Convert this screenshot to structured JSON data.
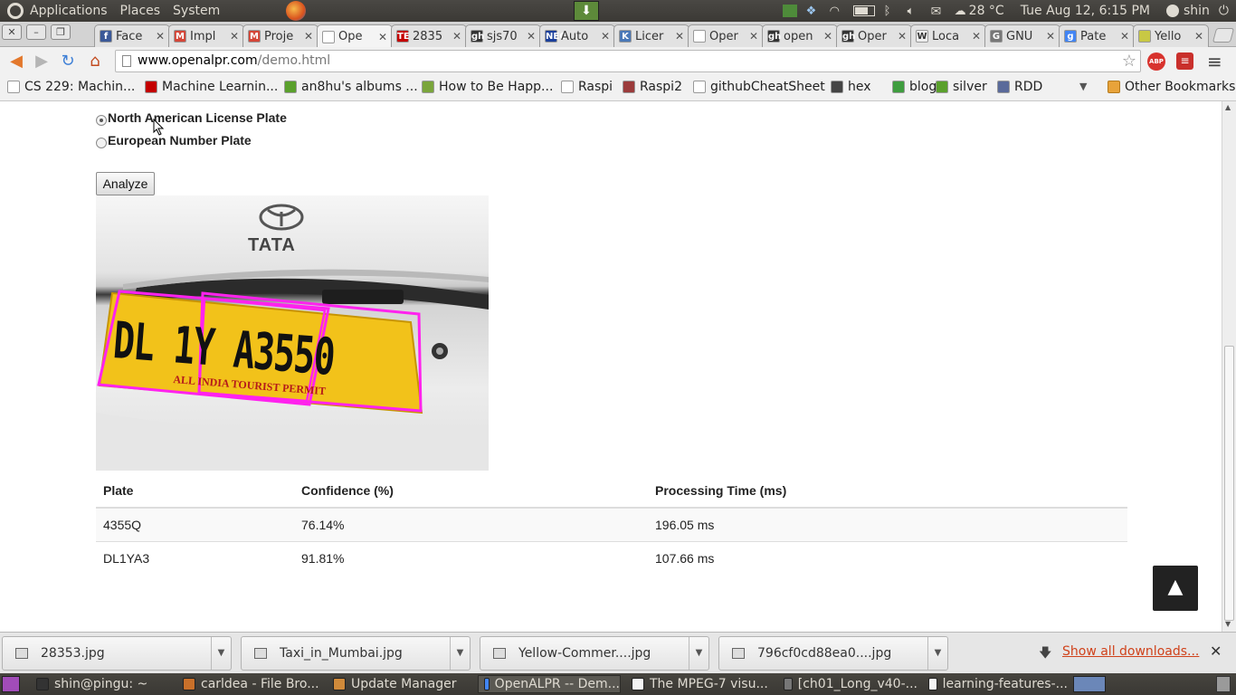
{
  "panel": {
    "menus": [
      "Applications",
      "Places",
      "System"
    ],
    "temperature": "28 °C",
    "datetime": "Tue Aug 12,  6:15 PM",
    "user": "shin"
  },
  "tabs": [
    {
      "title": "Face",
      "fav": "f",
      "color": "#3b5998"
    },
    {
      "title": "Impl",
      "fav": "M",
      "color": "#d44638"
    },
    {
      "title": "Proje",
      "fav": "M",
      "color": "#d44638"
    },
    {
      "title": "Ope",
      "fav": "",
      "color": "#ffffff"
    },
    {
      "title": "2835",
      "fav": "TE",
      "color": "#c40000"
    },
    {
      "title": "sjs70",
      "fav": "gh",
      "color": "#333333"
    },
    {
      "title": "Auto",
      "fav": "NEC",
      "color": "#1a3f9b"
    },
    {
      "title": "Licer",
      "fav": "K",
      "color": "#4a78b7"
    },
    {
      "title": "Oper",
      "fav": "",
      "color": "#ffffff"
    },
    {
      "title": "open",
      "fav": "gh",
      "color": "#333333"
    },
    {
      "title": "Oper",
      "fav": "gh",
      "color": "#333333"
    },
    {
      "title": "Loca",
      "fav": "W",
      "color": "#eeeeee"
    },
    {
      "title": "GNU",
      "fav": "G",
      "color": "#777777"
    },
    {
      "title": "Pate",
      "fav": "g",
      "color": "#4285f4"
    },
    {
      "title": "Yello",
      "fav": "",
      "color": "#c8c844"
    }
  ],
  "omnibox": {
    "domain": "www.openalpr.com",
    "path": "/demo.html"
  },
  "bookmarks": [
    {
      "label": "CS 229: Machin...",
      "color": "#ffffff"
    },
    {
      "label": "Machine Learnin...",
      "color": "#c40000"
    },
    {
      "label": "an8hu's albums ...",
      "color": "#5aa02c"
    },
    {
      "label": "How to Be Happ...",
      "color": "#7aa53b"
    },
    {
      "label": "Raspi",
      "color": "#ffffff"
    },
    {
      "label": "Raspi2",
      "color": "#9b3b3b"
    },
    {
      "label": "githubCheatSheet",
      "color": "#ffffff"
    },
    {
      "label": "hex",
      "color": "#444444"
    },
    {
      "label": "blog",
      "color": "#3f9d3f"
    },
    {
      "label": "silver",
      "color": "#5aa02c"
    },
    {
      "label": "RDD",
      "color": "#5a6a9a"
    }
  ],
  "other_bookmarks": "Other Bookmarks",
  "form": {
    "option_na": "North American License Plate",
    "option_eu": "European Number Plate",
    "analyze_label": "Analyze"
  },
  "car_image": {
    "brand": "TATA",
    "plate_text": "DL 1Y A3550",
    "permit_text": "ALL INDIA TOURIST PERMIT"
  },
  "results": {
    "headers": [
      "Plate",
      "Confidence (%)",
      "Processing Time (ms)"
    ],
    "rows": [
      {
        "plate": "4355Q",
        "confidence": "76.14%",
        "time": "196.05 ms"
      },
      {
        "plate": "DL1YA3",
        "confidence": "91.81%",
        "time": "107.66 ms"
      }
    ]
  },
  "downloads": {
    "items": [
      "28353.jpg",
      "Taxi_in_Mumbai.jpg",
      "Yellow-Commer....jpg",
      "796cf0cd88ea0....jpg"
    ],
    "show_all": "Show all downloads..."
  },
  "taskbar": [
    {
      "label": "shin@pingu: ~",
      "color": "#333333"
    },
    {
      "label": "carldea - File Bro...",
      "color": "#c8702a"
    },
    {
      "label": "Update Manager",
      "color": "#d08a3a"
    },
    {
      "label": "OpenALPR -- Dem...",
      "color": "#4285f4"
    },
    {
      "label": "The MPEG-7 visu...",
      "color": "#f4f4f4"
    },
    {
      "label": "[ch01_Long_v40-...",
      "color": "#777777"
    },
    {
      "label": "learning-features-...",
      "color": "#f4f4f4"
    }
  ]
}
